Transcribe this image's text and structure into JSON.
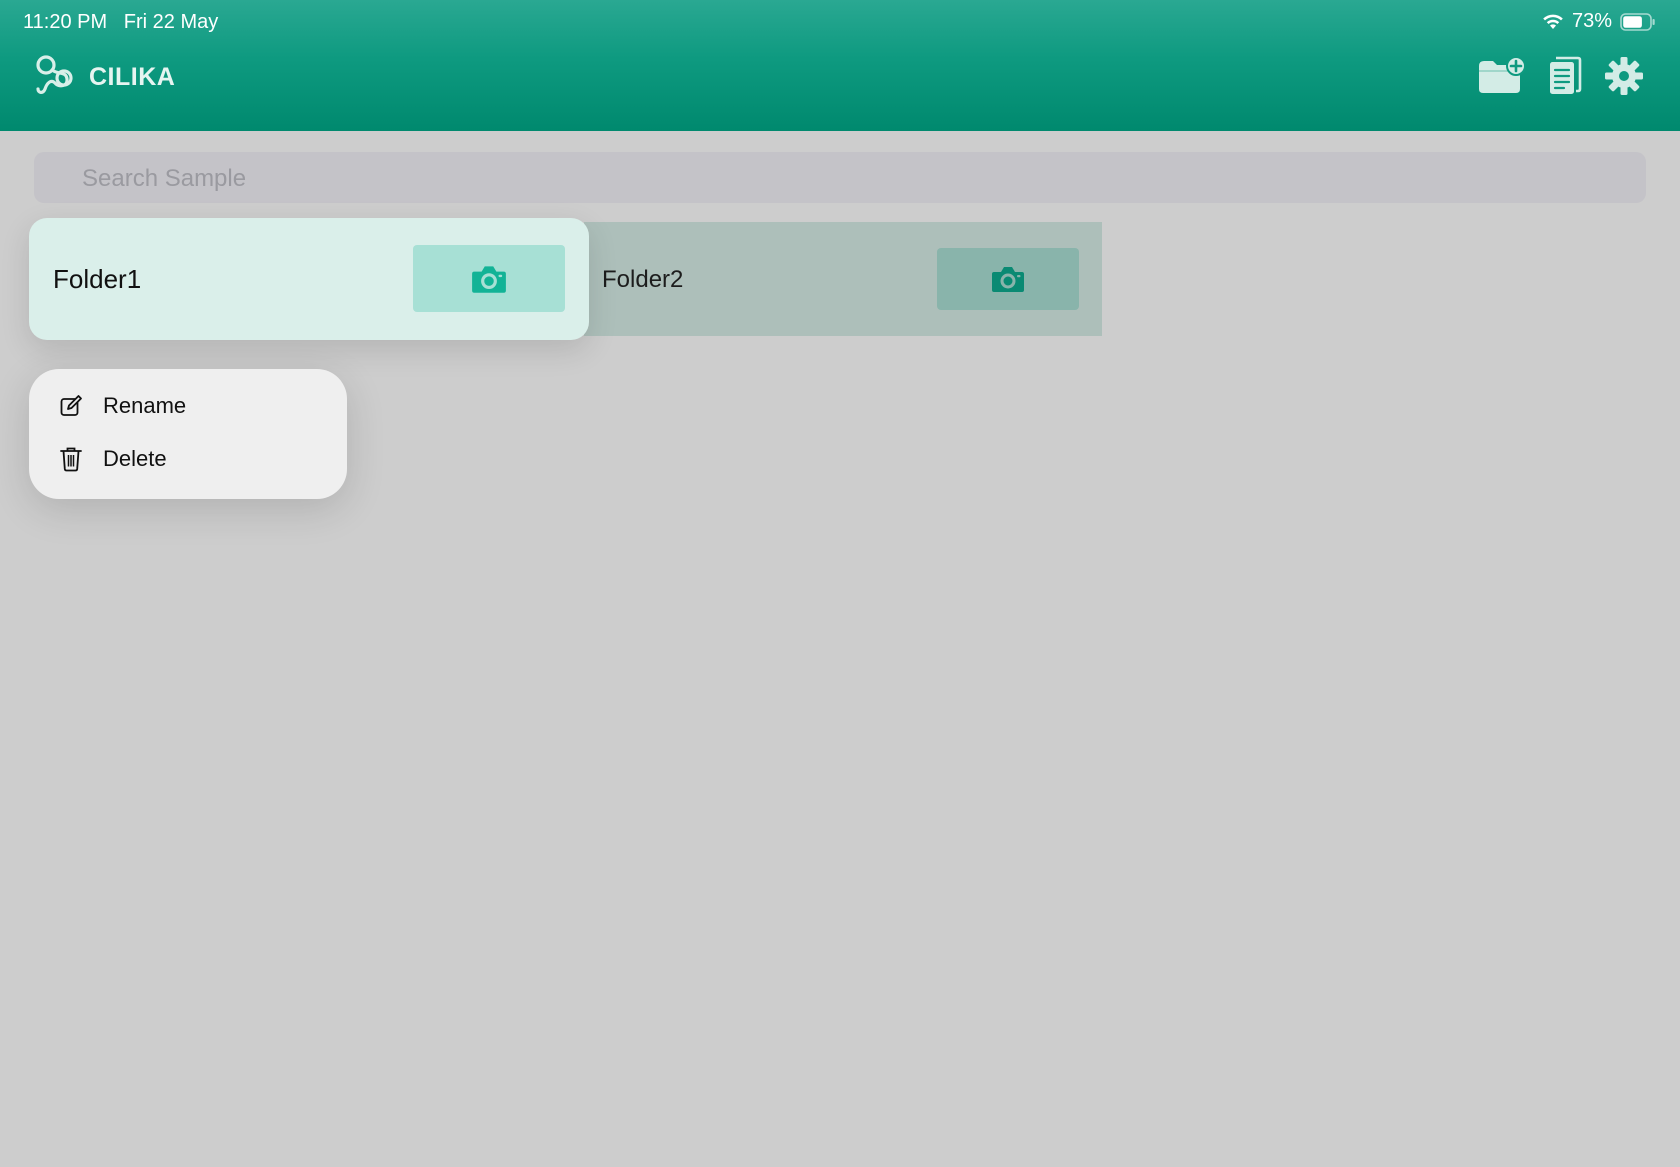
{
  "status_bar": {
    "time": "11:20 PM",
    "date": "Fri 22 May",
    "battery": "73%",
    "battery_level": 0.73
  },
  "header": {
    "app_name": "CILIKA",
    "brand_color": "#009a7e",
    "actions": [
      {
        "icon": "add-folder-icon"
      },
      {
        "icon": "document-icon"
      },
      {
        "icon": "gear-icon"
      }
    ]
  },
  "search": {
    "placeholder": "Search Sample",
    "value": ""
  },
  "folders": [
    {
      "name": "Folder1",
      "icon": "camera-icon",
      "selected": true
    },
    {
      "name": "Folder2",
      "icon": "camera-icon",
      "selected": false
    }
  ],
  "context_menu": {
    "items": [
      {
        "label": "Rename",
        "icon": "edit-icon"
      },
      {
        "label": "Delete",
        "icon": "trash-icon"
      }
    ]
  }
}
